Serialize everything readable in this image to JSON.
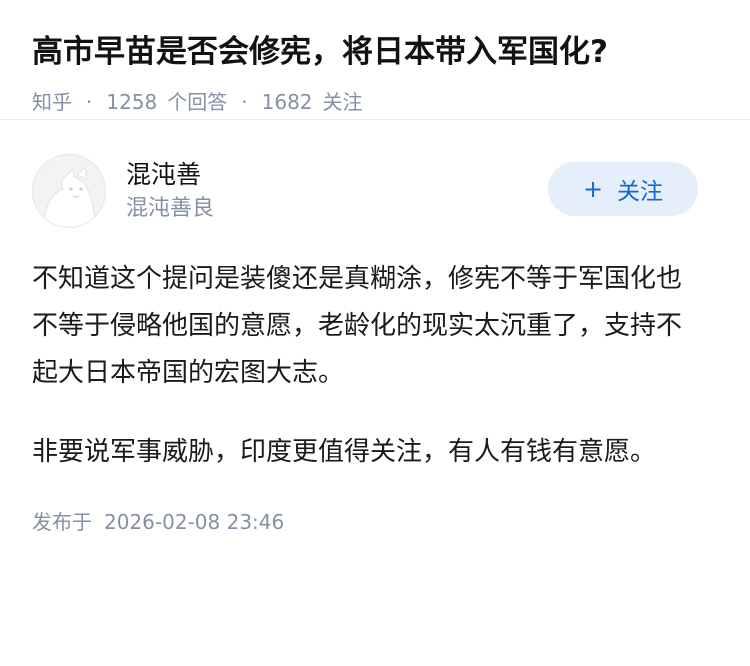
{
  "question": {
    "title": "高市早苗是否会修宪，将日本带入军国化?",
    "source": "知乎",
    "separator": "·",
    "answer_count": "1258",
    "answer_label": "个回答",
    "follower_count": "1682",
    "follower_label": "关注"
  },
  "answer": {
    "author": {
      "name": "混沌善",
      "headline": "混沌善良",
      "avatar_icon": "default-avatar-icon"
    },
    "follow_button": {
      "icon": "+",
      "label": "关注",
      "color": "#1766d6",
      "background": "#e5eefb"
    },
    "paragraphs": [
      "不知道这个提问是装傻还是真糊涂，修宪不等于军国化也不等于侵略他国的意愿，老龄化的现实太沉重了，支持不起大日本帝国的宏图大志。",
      "非要说军事威胁，印度更值得关注，有人有钱有意愿。"
    ],
    "publish_label": "发布于",
    "publish_time": "2026-02-08 23:46"
  }
}
